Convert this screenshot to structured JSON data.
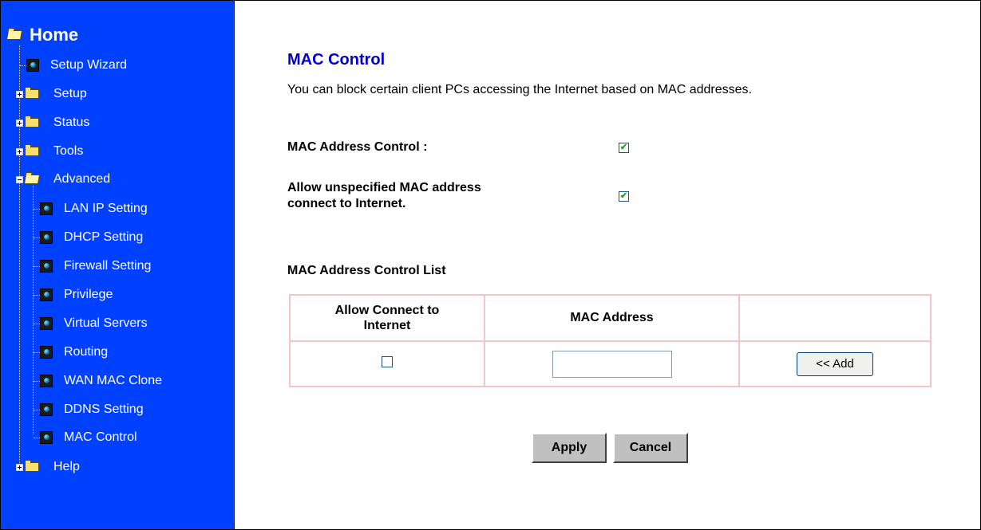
{
  "sidebar": {
    "root_label": "Home",
    "items": [
      {
        "label": "Setup Wizard"
      },
      {
        "label": "Setup"
      },
      {
        "label": "Status"
      },
      {
        "label": "Tools"
      },
      {
        "label": "Advanced"
      },
      {
        "label": "LAN IP Setting"
      },
      {
        "label": "DHCP Setting"
      },
      {
        "label": "Firewall Setting"
      },
      {
        "label": "Privilege"
      },
      {
        "label": "Virtual Servers"
      },
      {
        "label": "Routing"
      },
      {
        "label": "WAN MAC Clone"
      },
      {
        "label": "DDNS Setting"
      },
      {
        "label": "MAC Control"
      },
      {
        "label": "Help"
      }
    ]
  },
  "main": {
    "title": "MAC Control",
    "description": "You can block certain client PCs accessing the Internet based on MAC addresses.",
    "mac_control_label": "MAC Address Control :",
    "mac_control_checked": true,
    "allow_unspecified_label_line1": "Allow unspecified MAC address",
    "allow_unspecified_label_line2": "connect to Internet.",
    "allow_unspecified_checked": true,
    "list_title": "MAC Address Control List",
    "table": {
      "headers": [
        "Allow Connect to Internet",
        "MAC Address",
        ""
      ],
      "header_col1_line1": "Allow Connect to",
      "header_col1_line2": "Internet",
      "row_allow_checked": false,
      "mac_value": "",
      "add_label": "<< Add"
    },
    "apply_label": "Apply",
    "cancel_label": "Cancel"
  },
  "colors": {
    "sidebar_bg": "#0040ff",
    "title": "#0000cc",
    "table_border": "#f2c6c6",
    "button_gray": "#c0c0c0"
  }
}
